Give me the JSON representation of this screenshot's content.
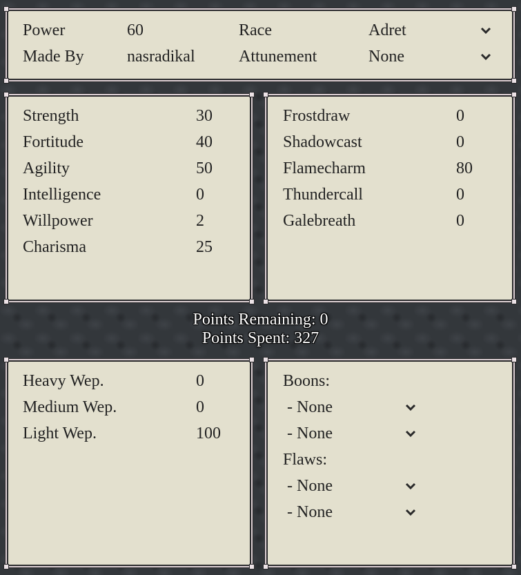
{
  "header": {
    "power_label": "Power",
    "power_value": "60",
    "made_by_label": "Made By",
    "made_by_value": "nasradikal",
    "race_label": "Race",
    "race_value": "Adret",
    "attunement_label": "Attunement",
    "attunement_value": "None",
    "dropdown_icon": "chevron-down-icon"
  },
  "attributes": [
    {
      "label": "Strength",
      "value": "30"
    },
    {
      "label": "Fortitude",
      "value": "40"
    },
    {
      "label": "Agility",
      "value": "50"
    },
    {
      "label": "Intelligence",
      "value": "0"
    },
    {
      "label": "Willpower",
      "value": "2"
    },
    {
      "label": "Charisma",
      "value": "25"
    }
  ],
  "attunements": [
    {
      "label": "Frostdraw",
      "value": "0"
    },
    {
      "label": "Shadowcast",
      "value": "0"
    },
    {
      "label": "Flamecharm",
      "value": "80"
    },
    {
      "label": "Thundercall",
      "value": "0"
    },
    {
      "label": "Galebreath",
      "value": "0"
    }
  ],
  "points": {
    "remaining": "Points Remaining: 0",
    "spent": "Points Spent: 327"
  },
  "weapons": [
    {
      "label": "Heavy Wep.",
      "value": "0"
    },
    {
      "label": "Medium Wep.",
      "value": "0"
    },
    {
      "label": "Light Wep.",
      "value": "100"
    }
  ],
  "boons": {
    "title": "Boons:",
    "items": [
      "- None",
      "- None"
    ]
  },
  "flaws": {
    "title": "Flaws:",
    "items": [
      "- None",
      "- None"
    ]
  },
  "colors": {
    "panel_bg": "#e3e0ce",
    "page_bg": "#33373b",
    "border_light": "#ddd0d4",
    "text": "#222222"
  }
}
